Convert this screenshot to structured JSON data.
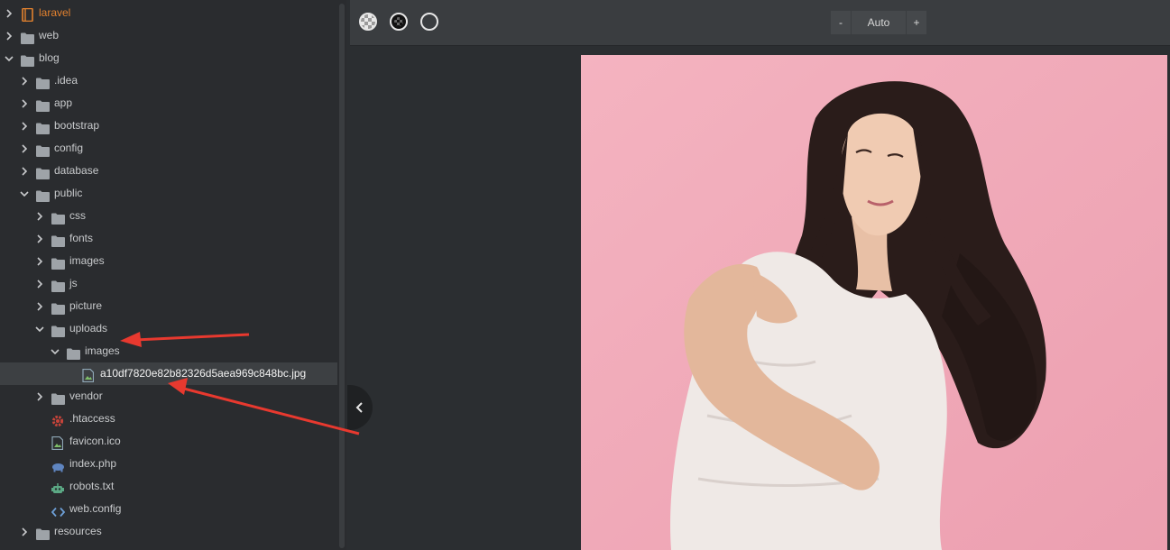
{
  "tree": [
    {
      "label": "laravel",
      "indent": 0,
      "chev": "right",
      "icon": "book",
      "root": true
    },
    {
      "label": "web",
      "indent": 0,
      "chev": "right",
      "icon": "folder"
    },
    {
      "label": "blog",
      "indent": 0,
      "chev": "down",
      "icon": "folder"
    },
    {
      "label": ".idea",
      "indent": 1,
      "chev": "right",
      "icon": "folder"
    },
    {
      "label": "app",
      "indent": 1,
      "chev": "right",
      "icon": "folder"
    },
    {
      "label": "bootstrap",
      "indent": 1,
      "chev": "right",
      "icon": "folder"
    },
    {
      "label": "config",
      "indent": 1,
      "chev": "right",
      "icon": "folder"
    },
    {
      "label": "database",
      "indent": 1,
      "chev": "right",
      "icon": "folder"
    },
    {
      "label": "public",
      "indent": 1,
      "chev": "down",
      "icon": "folder"
    },
    {
      "label": "css",
      "indent": 2,
      "chev": "right",
      "icon": "folder"
    },
    {
      "label": "fonts",
      "indent": 2,
      "chev": "right",
      "icon": "folder"
    },
    {
      "label": "images",
      "indent": 2,
      "chev": "right",
      "icon": "folder"
    },
    {
      "label": "js",
      "indent": 2,
      "chev": "right",
      "icon": "folder"
    },
    {
      "label": "picture",
      "indent": 2,
      "chev": "right",
      "icon": "folder"
    },
    {
      "label": "uploads",
      "indent": 2,
      "chev": "down",
      "icon": "folder"
    },
    {
      "label": "images",
      "indent": 3,
      "chev": "down",
      "icon": "folder"
    },
    {
      "label": "a10df7820e82b82326d5aea969c848bc.jpg",
      "indent": 4,
      "chev": "none",
      "icon": "image-file",
      "selected": true
    },
    {
      "label": "vendor",
      "indent": 2,
      "chev": "right",
      "icon": "folder"
    },
    {
      "label": ".htaccess",
      "indent": 2,
      "chev": "none",
      "icon": "gear"
    },
    {
      "label": "favicon.ico",
      "indent": 2,
      "chev": "none",
      "icon": "image-file"
    },
    {
      "label": "index.php",
      "indent": 2,
      "chev": "none",
      "icon": "php"
    },
    {
      "label": "robots.txt",
      "indent": 2,
      "chev": "none",
      "icon": "robot"
    },
    {
      "label": "web.config",
      "indent": 2,
      "chev": "none",
      "icon": "code"
    },
    {
      "label": "resources",
      "indent": 1,
      "chev": "right",
      "icon": "folder"
    }
  ],
  "toolbar": {
    "zoom_minus": "-",
    "zoom_value": "Auto",
    "zoom_plus": "+"
  },
  "colors": {
    "root_label": "#e2812f",
    "folder_icon": "#9ea3a8",
    "arrow": "#e8392f",
    "photo_bg": "#f1a9b8"
  }
}
